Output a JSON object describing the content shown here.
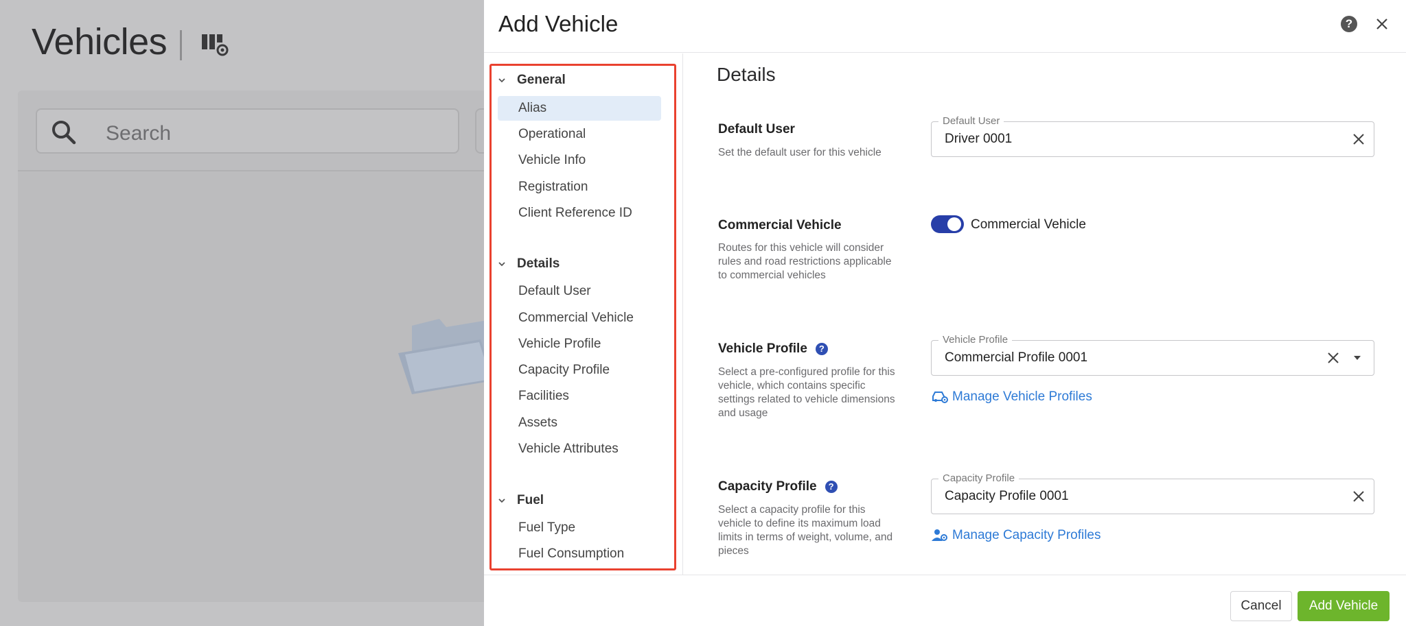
{
  "background": {
    "title": "Vehicles",
    "search_placeholder": "Search"
  },
  "modal": {
    "title": "Add Vehicle",
    "nav": {
      "groups": [
        {
          "label": "General",
          "items": [
            "Alias",
            "Operational",
            "Vehicle Info",
            "Registration",
            "Client Reference ID"
          ]
        },
        {
          "label": "Details",
          "items": [
            "Default User",
            "Commercial Vehicle",
            "Vehicle Profile",
            "Capacity Profile",
            "Facilities",
            "Assets",
            "Vehicle Attributes"
          ]
        },
        {
          "label": "Fuel",
          "items": [
            "Fuel Type",
            "Fuel Consumption"
          ]
        }
      ],
      "active_item": "Alias"
    },
    "section_title": "Details",
    "default_user": {
      "label": "Default User",
      "description": "Set the default user for this vehicle",
      "field_legend": "Default User",
      "value": "Driver 0001"
    },
    "commercial_vehicle": {
      "label": "Commercial Vehicle",
      "description": "Routes for this vehicle will consider rules and road restrictions applicable to commercial vehicles",
      "toggle_label": "Commercial Vehicle",
      "toggle_on": true
    },
    "vehicle_profile": {
      "label": "Vehicle Profile",
      "description": "Select a pre-configured profile for this vehicle, which contains specific settings related to vehicle dimensions and usage",
      "field_legend": "Vehicle Profile",
      "value": "Commercial Profile 0001",
      "link": "Manage Vehicle Profiles"
    },
    "capacity_profile": {
      "label": "Capacity Profile",
      "description": "Select a capacity profile for this vehicle to define its maximum load limits in terms of weight, volume, and pieces",
      "field_legend": "Capacity Profile",
      "value": "Capacity Profile 0001",
      "link": "Manage Capacity Profiles"
    },
    "footer": {
      "cancel_label": "Cancel",
      "submit_label": "Add Vehicle"
    }
  },
  "colors": {
    "accent_blue": "#273ea8",
    "link_blue": "#2d7ad6",
    "primary_green": "#6db52c",
    "highlight_red": "#e9412f",
    "active_nav_bg": "#e2ecf8"
  }
}
